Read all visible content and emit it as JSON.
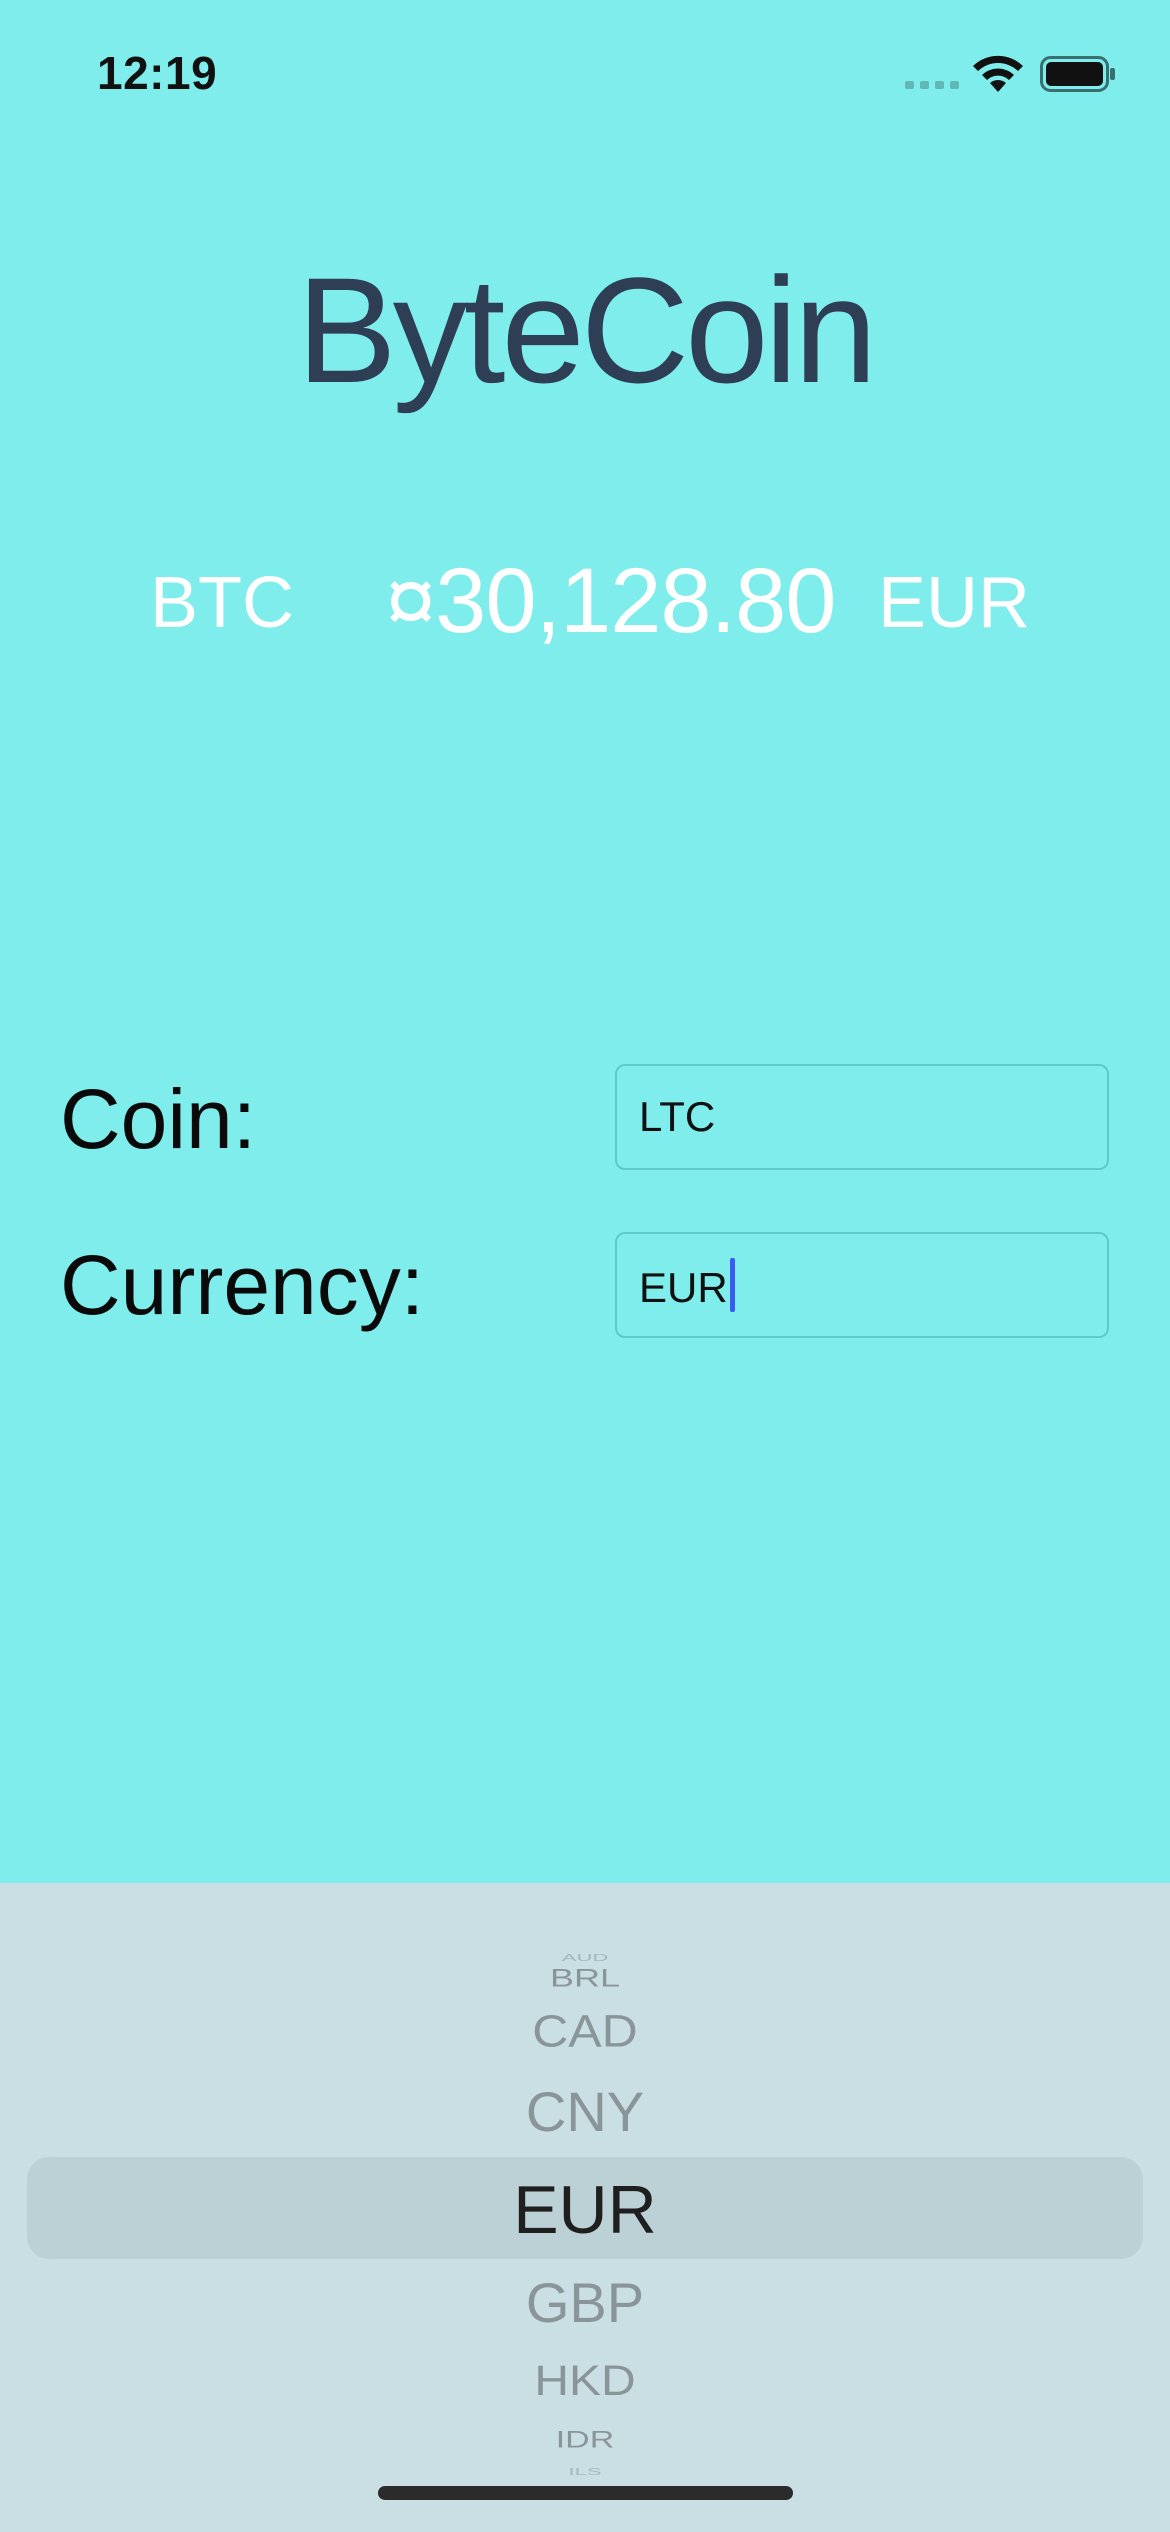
{
  "status_bar": {
    "time": "12:19",
    "icons": [
      "cellular-signal-icon",
      "wifi-icon",
      "battery-icon"
    ]
  },
  "app": {
    "title": "ByteCoin"
  },
  "rate": {
    "coin": "BTC",
    "value": "¤30,128.80",
    "currency": "EUR"
  },
  "form": {
    "coin_label": "Coin:",
    "coin_value": "LTC",
    "currency_label": "Currency:",
    "currency_value": "EUR"
  },
  "picker": {
    "items": [
      "AUD",
      "BRL",
      "CAD",
      "CNY",
      "EUR",
      "GBP",
      "HKD",
      "IDR",
      "ILS"
    ],
    "selected": "EUR"
  },
  "colors": {
    "background": "#7EEDEB",
    "title": "#2E3E55",
    "rate_text": "#FFFFFF",
    "picker_background": "#C9DFE3",
    "caret": "#3B5BF0"
  }
}
